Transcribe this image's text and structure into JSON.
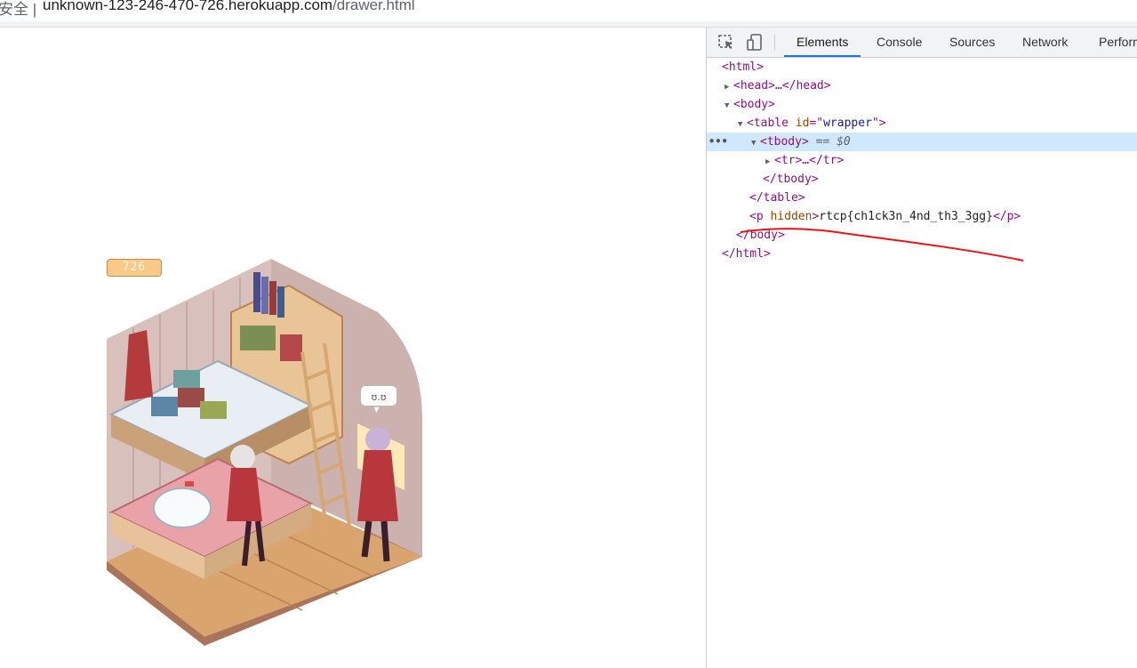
{
  "address_bar": {
    "security_label": "安全 |",
    "url_host": "unknown-123-246-470-726.herokuapp.com",
    "url_path": "/drawer.html"
  },
  "page": {
    "badge_number": "726",
    "speech_bubble": "ʊ.ʊ"
  },
  "devtools": {
    "tabs": [
      "Elements",
      "Console",
      "Sources",
      "Network",
      "Perform"
    ],
    "active_tab": "Elements",
    "dom": {
      "html_open": "<html>",
      "head": "<head>…</head>",
      "body_open": "<body>",
      "table_open_tag": "<table",
      "table_attr_name": "id",
      "table_attr_eq": "=\"",
      "table_attr_value": "wrapper",
      "table_attr_close": "\">",
      "tbody_open": "<tbody>",
      "tbody_marker": "== $0",
      "tr": "<tr>…</tr>",
      "tbody_close": "</tbody>",
      "table_close": "</table>",
      "p_open_tag": "<p",
      "p_attr": "hidden",
      "p_open_end": ">",
      "p_text": "rtcp{ch1ck3n_4nd_th3_3gg}",
      "p_close": "</p>",
      "body_close": "</body>",
      "html_close": "</html>",
      "ellipsis": "•••"
    }
  },
  "colors": {
    "accent": "#1a73e8",
    "tag": "#881280",
    "attr_name": "#994500",
    "attr_value": "#1a1aa6",
    "selected_row": "#cfe8fc",
    "annotation": "#e8141a"
  }
}
